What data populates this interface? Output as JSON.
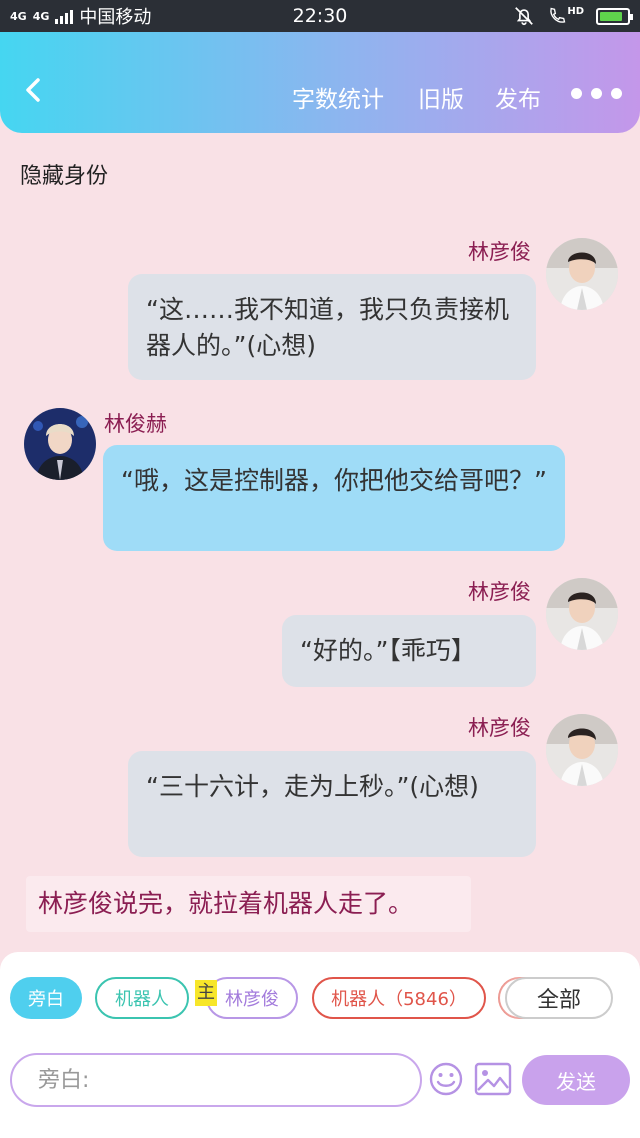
{
  "status_bar": {
    "network": "4G",
    "network2": "4G",
    "carrier": "中国移动",
    "time": "22:30",
    "hd_label": "HD",
    "battery_level": 0.85
  },
  "header": {
    "word_count_label": "字数统计",
    "old_version_label": "旧版",
    "publish_label": "发布"
  },
  "hide_identity_label": "隐藏身份",
  "messages": [
    {
      "speaker": "林彦俊",
      "text": "“这……我不知道，我只负责接机器人的。”(心想)",
      "side": "right",
      "color": "#dde1e8"
    },
    {
      "speaker": "林俊赫",
      "text": "“哦，这是控制器，你把他交给哥吧？”",
      "side": "left",
      "color": "#9fdcf7"
    },
    {
      "speaker": "林彦俊",
      "text": "“好的。”【乖巧】",
      "side": "right",
      "color": "#dde1e8"
    },
    {
      "speaker": "林彦俊",
      "text": "“三十六计，走为上秒。”(心想)",
      "side": "right",
      "color": "#dde1e8"
    }
  ],
  "narration_text": "林彦俊说完，就拉着机器人走了。",
  "role_chips": {
    "narration": "旁白",
    "robot": "机器人",
    "main_badge": "主",
    "lin": "林彦俊",
    "robot_id": "机器人（5846）",
    "all": "全部"
  },
  "input": {
    "placeholder": "旁白:"
  },
  "send_label": "发送",
  "colors": {
    "accent_cyan": "#45d6f1",
    "accent_purple": "#c497ea",
    "speaker": "#8b1e52"
  }
}
